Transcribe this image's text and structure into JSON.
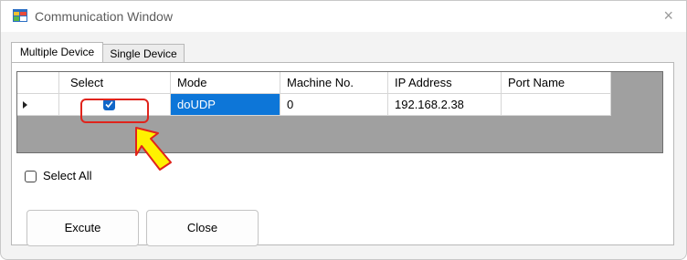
{
  "window": {
    "title": "Communication  Window",
    "close_glyph": "×"
  },
  "tabs": [
    {
      "label": "Multiple Device",
      "active": true
    },
    {
      "label": "Single Device",
      "active": false
    }
  ],
  "grid": {
    "columns": [
      "Select",
      "Mode",
      "Machine No.",
      "IP Address",
      "Port Name"
    ],
    "rows": [
      {
        "select": true,
        "mode": "doUDP",
        "machine_no": "0",
        "ip_address": "192.168.2.38",
        "port_name": ""
      }
    ]
  },
  "select_all": {
    "label": "Select All",
    "checked": false
  },
  "buttons": {
    "execute": "Excute",
    "close": "Close"
  },
  "colors": {
    "accent": "#1166c8",
    "selection": "#0d76d8",
    "annotation_red": "#e0241c",
    "annotation_yellow": "#fff200"
  }
}
